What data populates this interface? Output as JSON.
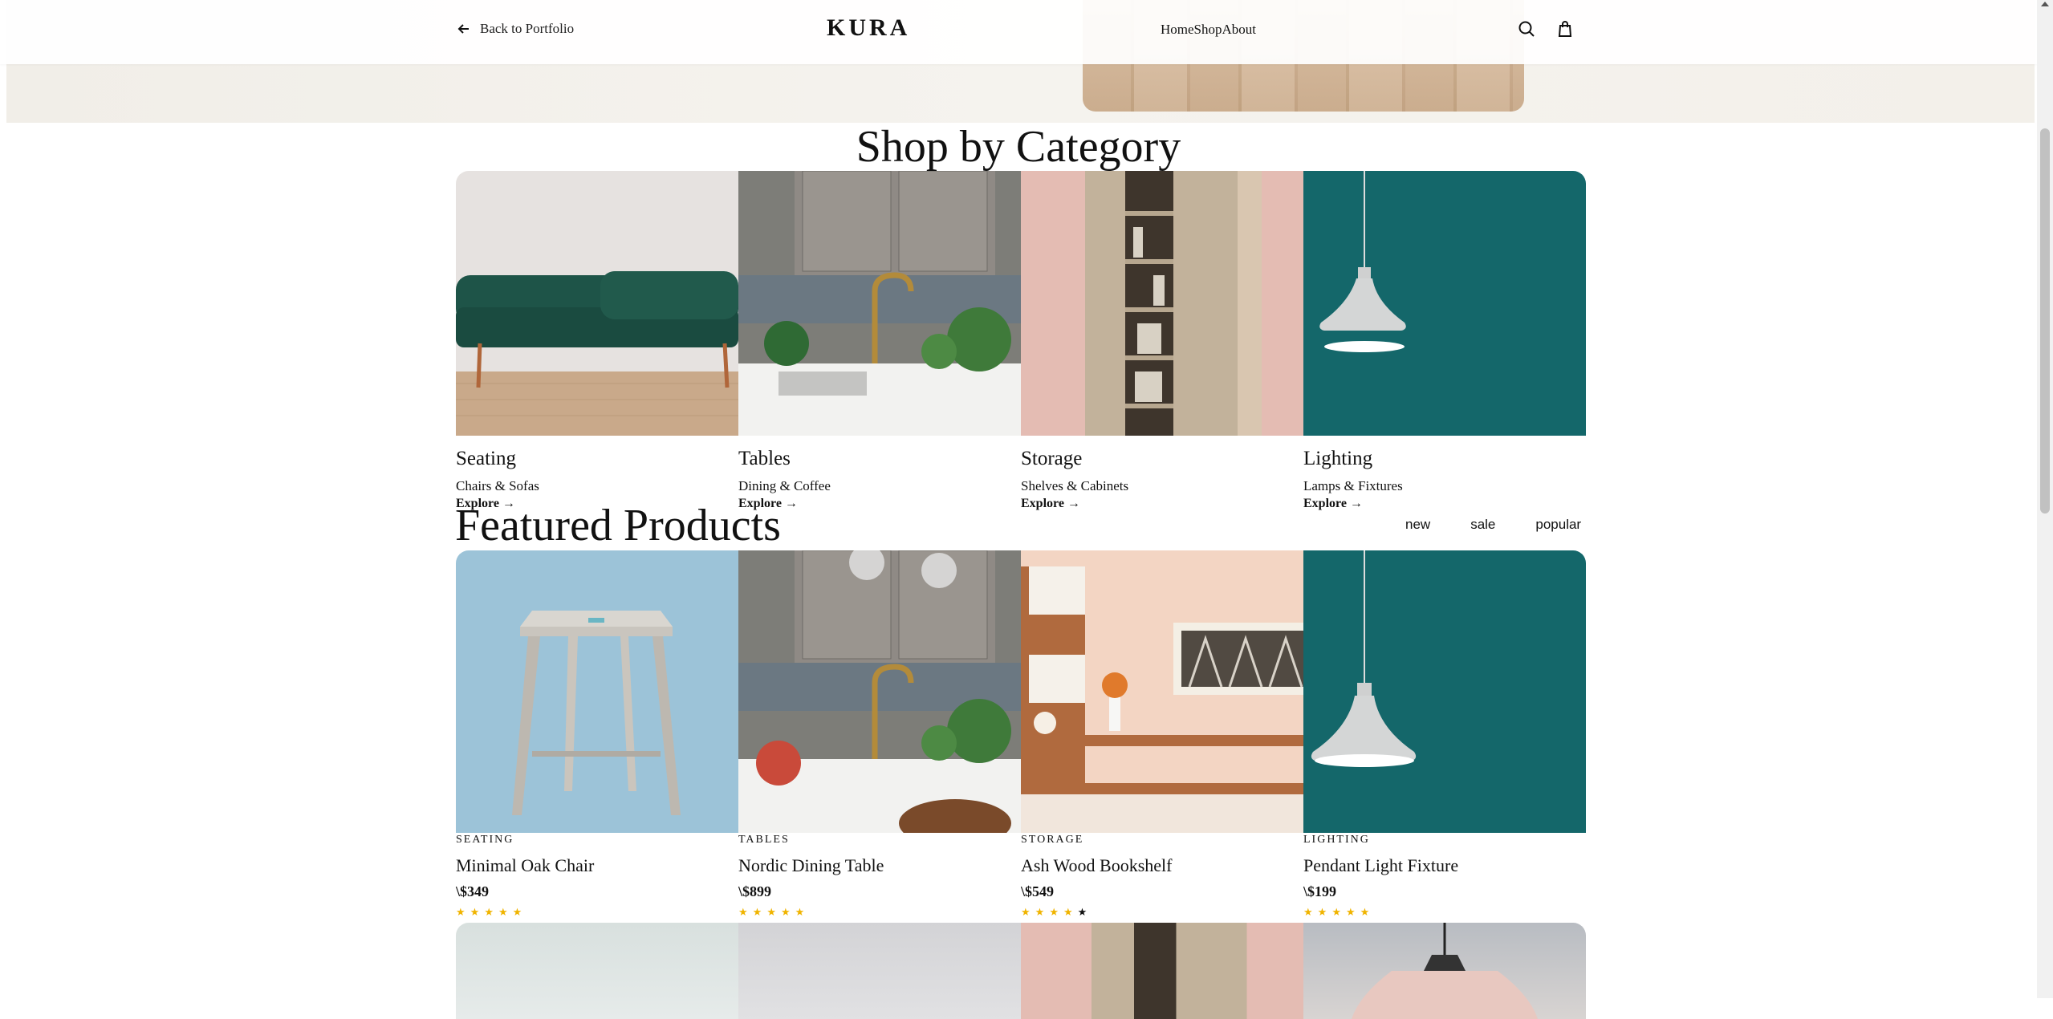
{
  "header": {
    "back_label": "Back to Portfolio",
    "logo": "KURA",
    "nav": [
      "Home",
      "Shop",
      "About"
    ]
  },
  "categories_section": {
    "title": "Shop by Category",
    "items": [
      {
        "name": "Seating",
        "sub": "Chairs & Sofas",
        "link": "Explore →"
      },
      {
        "name": "Tables",
        "sub": "Dining & Coffee",
        "link": "Explore →"
      },
      {
        "name": "Storage",
        "sub": "Shelves & Cabinets",
        "link": "Explore →"
      },
      {
        "name": "Lighting",
        "sub": "Lamps & Fixtures",
        "link": "Explore →"
      }
    ]
  },
  "featured": {
    "title": "Featured Products",
    "filters": [
      "new",
      "sale",
      "popular"
    ],
    "products": [
      {
        "category": "SEATING",
        "name": "Minimal Oak Chair",
        "price": "\\$349",
        "rating": 5
      },
      {
        "category": "TABLES",
        "name": "Nordic Dining Table",
        "price": "\\$899",
        "rating": 5
      },
      {
        "category": "STORAGE",
        "name": "Ash Wood Bookshelf",
        "price": "\\$549",
        "rating": 4
      },
      {
        "category": "LIGHTING",
        "name": "Pendant Light Fixture",
        "price": "\\$199",
        "rating": 5
      }
    ]
  },
  "icons": {
    "back": "arrow-left-icon",
    "search": "search-icon",
    "cart": "shopping-bag-icon",
    "star": "star-icon"
  },
  "colors": {
    "star": "#f0b400",
    "text": "#111111",
    "hero_bg": "#f3f0ea"
  }
}
